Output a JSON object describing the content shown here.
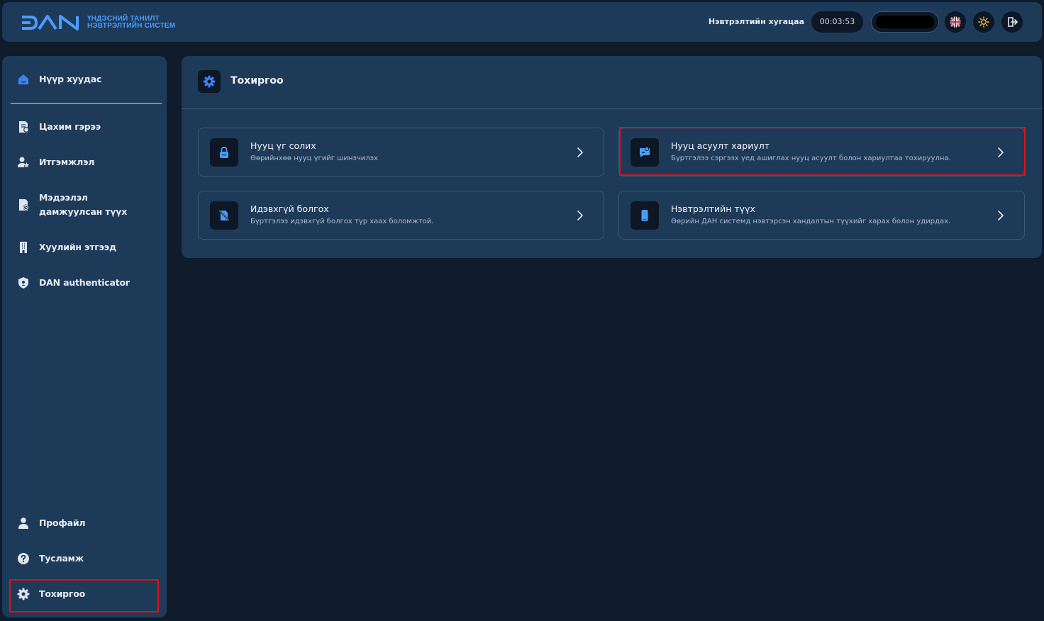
{
  "header": {
    "logo_text": "DAN",
    "logo_line1": "ҮНДЭСНИЙ ТАНИЛТ",
    "logo_line2": "НЭВТРЭЛТИЙН СИСТЕМ",
    "session_label": "Нэвтрэлтийн хугацаа",
    "session_timer": "00:03:53",
    "icons": [
      "uk-flag-icon",
      "sun-icon",
      "logout-icon"
    ]
  },
  "sidebar": {
    "items": [
      {
        "label": "Нүүр хуудас",
        "icon": "home-icon"
      },
      {
        "label": "Цахим гэрээ",
        "icon": "document-icon"
      },
      {
        "label": "Итгэмжлэл",
        "icon": "user-star-icon"
      },
      {
        "label": "Мэдээлэл дамжуулсан түүх",
        "icon": "history-doc-icon"
      },
      {
        "label": "Хуулийн этгээд",
        "icon": "building-icon"
      },
      {
        "label": "DAN authenticator",
        "icon": "shield-icon"
      }
    ],
    "bottom_items": [
      {
        "label": "Профайл",
        "icon": "user-icon"
      },
      {
        "label": "Тусламж",
        "icon": "help-icon"
      },
      {
        "label": "Тохиргоо",
        "icon": "gear-icon"
      }
    ]
  },
  "main": {
    "title": "Тохиргоо",
    "cards": [
      {
        "title": "Нууц үг солих",
        "description": "Өөрийнхөө нууц үгийг шинэчилэх",
        "icon": "lock-icon"
      },
      {
        "title": "Нууц асуулт хариулт",
        "description": "Бүртгэлээ сэргээх үед ашиглах нууц асуулт болон хариултаа тохируулна.",
        "icon": "chat-question-icon"
      },
      {
        "title": "Идэвхгүй болгох",
        "description": "Бүртгэлээ идэвхгүй болгох түр хаах боломжтой.",
        "icon": "deactivate-icon"
      },
      {
        "title": "Нэвтрэлтийн түүх",
        "description": "Өөрийн ДАН системд нэвтэрсэн хандалтын түүхийг харах болон удирдах.",
        "icon": "phone-icon"
      }
    ]
  },
  "colors": {
    "background": "#101b2c",
    "panel": "#1e3a59",
    "accent": "#4a9dff",
    "highlight": "#e0101a"
  }
}
